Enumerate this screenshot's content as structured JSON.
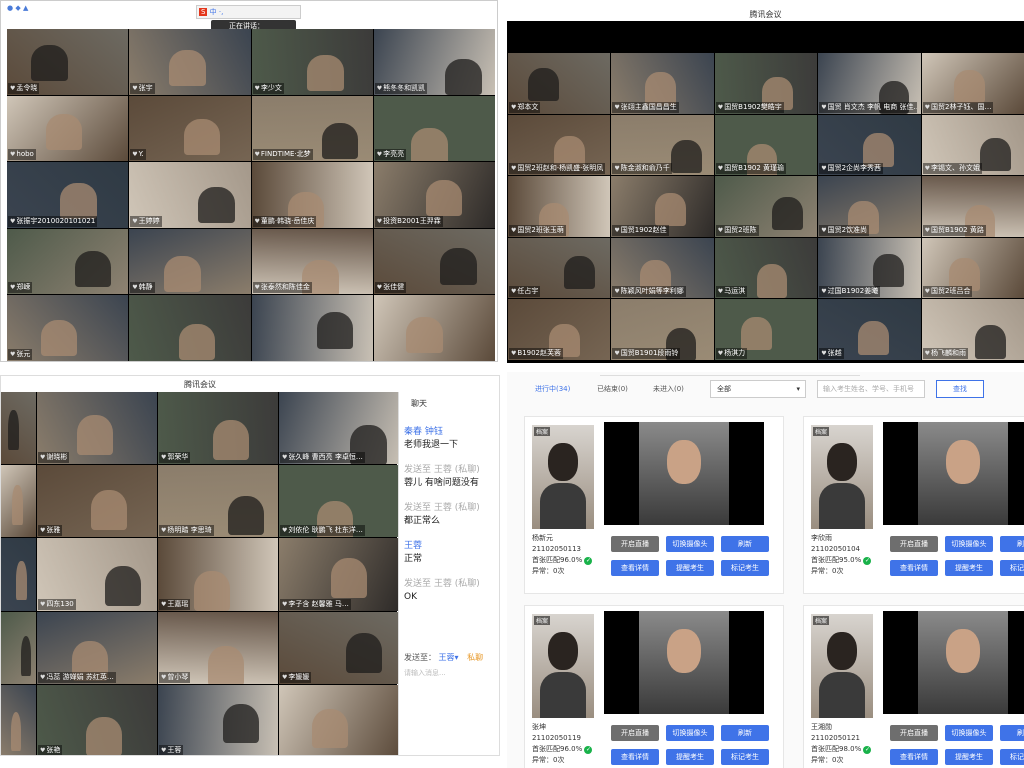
{
  "tl": {
    "title": "腾讯会议",
    "speaking": "正在讲话：",
    "tiles": [
      "孟令晓",
      "张宇",
      "李少文",
      "熊冬冬和凯凯",
      "hobo",
      "Y.",
      "FINDTIME·北梦",
      "李亮亮",
      "张振宇2010020101021",
      "王婷婷",
      "董鹏·韩骁·岳佳庆",
      "投资B2001王羿霖",
      "郑嵘",
      "韩静",
      "张泰然和陈佳金",
      "张佳健",
      "张元",
      "",
      "",
      ""
    ]
  },
  "tr": {
    "title": "腾讯会议",
    "tiles": [
      "郑本文",
      "张翊主鑫国昌昌生",
      "国贸B1902樊皓宇",
      "国贸 肖文杰 李帆 电商 张佳…",
      "国贸2林子钰、国…",
      "国贸2班赵和·杨凯盛·张明凤",
      "陈金淑和俞乃千",
      "国贸B1902 黄瑾瑜",
      "国贸2企尚李秀茜",
      "李锡文、孙文娥",
      "国贸2班张玉萌",
      "国贸1902赵佳",
      "国贸2班陈",
      "国贸2饮准尚",
      "国贸B1902 黄路",
      "任占宇",
      "陈颖风叶娟等李利娜",
      "马运淇",
      "过国B1902姜曦",
      "国贸2班吕合",
      "B1902赵芙蓉",
      "国贸B1901段雨铃",
      "杨淇力",
      "张越",
      "杨飞麟和雨"
    ]
  },
  "bl": {
    "title": "腾讯会议",
    "tiles": [
      "",
      "谢晓彬",
      "郭荣华",
      "张久峰 曹西亮 李卓恒…",
      "",
      "张雅",
      "杨明踏 李思琦",
      "刘依伦 耿鹏飞 杜东洋…",
      "",
      "四东130",
      "王嘉瑶",
      "李子含 赵馨雅 马…",
      "",
      "冯蕊 游婵娟 苏红英…",
      "曾小琴",
      "李媛媛",
      "",
      "张艳",
      "王蓉",
      ""
    ],
    "chat": {
      "header": "聊天",
      "messages": [
        {
          "sender": "秦春 钟钰",
          "text": "老师我退一下"
        },
        {
          "sender": "发送至 王蓉 (私聊)",
          "text": "蓉儿 有啥问题没有"
        },
        {
          "sender": "发送至 王蓉 (私聊)",
          "text": "都正常么"
        },
        {
          "sender": "王蓉",
          "text": "正常"
        },
        {
          "sender": "发送至 王蓉 (私聊)",
          "text": "OK"
        }
      ],
      "send_to_label": "发送至：",
      "send_to_value": "王蓉",
      "private": "私聊",
      "placeholder": "请输入消息..."
    }
  },
  "br": {
    "tabs": [
      "进行中(34)",
      "已结束(0)",
      "未进入(0)"
    ],
    "select": "全部",
    "search_placeholder": "输入考生姓名、学号、手机号",
    "search_btn": "查找",
    "cards": [
      {
        "tag": "档案",
        "name": "杨新元",
        "id": "21102050113",
        "match": "首张匹配96.0%",
        "abn": "异常：0次"
      },
      {
        "tag": "档案",
        "name": "李欣雨",
        "id": "21102050104",
        "match": "首张匹配95.0%",
        "abn": "异常：0次"
      },
      {
        "tag": "档案",
        "name": "张坤",
        "id": "21102050119",
        "match": "首张匹配96.0%",
        "abn": "异常：0次"
      },
      {
        "tag": "档案",
        "name": "王湘勋",
        "id": "21102050121",
        "match": "首张匹配98.0%",
        "abn": "异常：0次"
      }
    ],
    "btns": {
      "live": "开启直播",
      "cam": "切换摄像头",
      "refresh": "刷新",
      "detail": "查看详情",
      "remind": "提醒考生",
      "mark": "标记考生"
    }
  },
  "colors": {
    "accent": "#3f73e8",
    "green": "#19b24a"
  }
}
